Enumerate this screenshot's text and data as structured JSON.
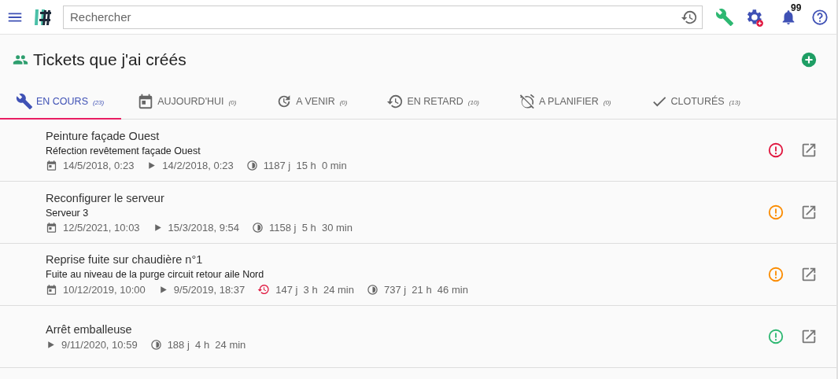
{
  "search": {
    "placeholder": "Rechercher"
  },
  "notifications": {
    "count": "99"
  },
  "page": {
    "title": "Tickets que j'ai créés"
  },
  "tabs": [
    {
      "label": "EN COURS",
      "count": "(23)",
      "selected": true
    },
    {
      "label": "AUJOURD'HUI",
      "count": "(0)",
      "selected": false
    },
    {
      "label": "A VENIR",
      "count": "(0)",
      "selected": false
    },
    {
      "label": "EN RETARD",
      "count": "(10)",
      "selected": false
    },
    {
      "label": "A PLANIFIER",
      "count": "(0)",
      "selected": false
    },
    {
      "label": "CLOTURÉS",
      "count": "(13)",
      "selected": false
    }
  ],
  "tickets": [
    {
      "title": "Peinture façade Ouest",
      "description": "Réfection revêtement façade Ouest",
      "color": "#e0173f",
      "meta": [
        {
          "kind": "planned",
          "text": "14/5/2018, 0:23"
        },
        {
          "kind": "start",
          "text": "14/2/2018, 0:23"
        },
        {
          "kind": "duration",
          "text": "1187 j  15 h  0 min"
        }
      ]
    },
    {
      "title": "Reconfigurer le serveur",
      "description": "Serveur 3",
      "color": "#fb8c00",
      "meta": [
        {
          "kind": "planned",
          "text": "12/5/2021, 10:03"
        },
        {
          "kind": "start",
          "text": "15/3/2018, 9:54"
        },
        {
          "kind": "duration",
          "text": "1158 j  5 h  30 min"
        }
      ]
    },
    {
      "title": "Reprise fuite sur chaudière n°1",
      "description": "Fuite au niveau de la purge circuit retour aile Nord",
      "color": "#fb8c00",
      "meta": [
        {
          "kind": "planned",
          "text": "10/12/2019, 10:00"
        },
        {
          "kind": "start",
          "text": "9/5/2019, 18:37"
        },
        {
          "kind": "late",
          "text": "147 j  3 h  24 min"
        },
        {
          "kind": "duration",
          "text": "737 j  21 h  46 min"
        }
      ]
    },
    {
      "title": "Arrêt emballeuse",
      "color": "#2eb872",
      "meta": [
        {
          "kind": "start",
          "text": "9/11/2020, 10:59"
        },
        {
          "kind": "duration",
          "text": "188 j  4 h  24 min"
        }
      ]
    }
  ]
}
